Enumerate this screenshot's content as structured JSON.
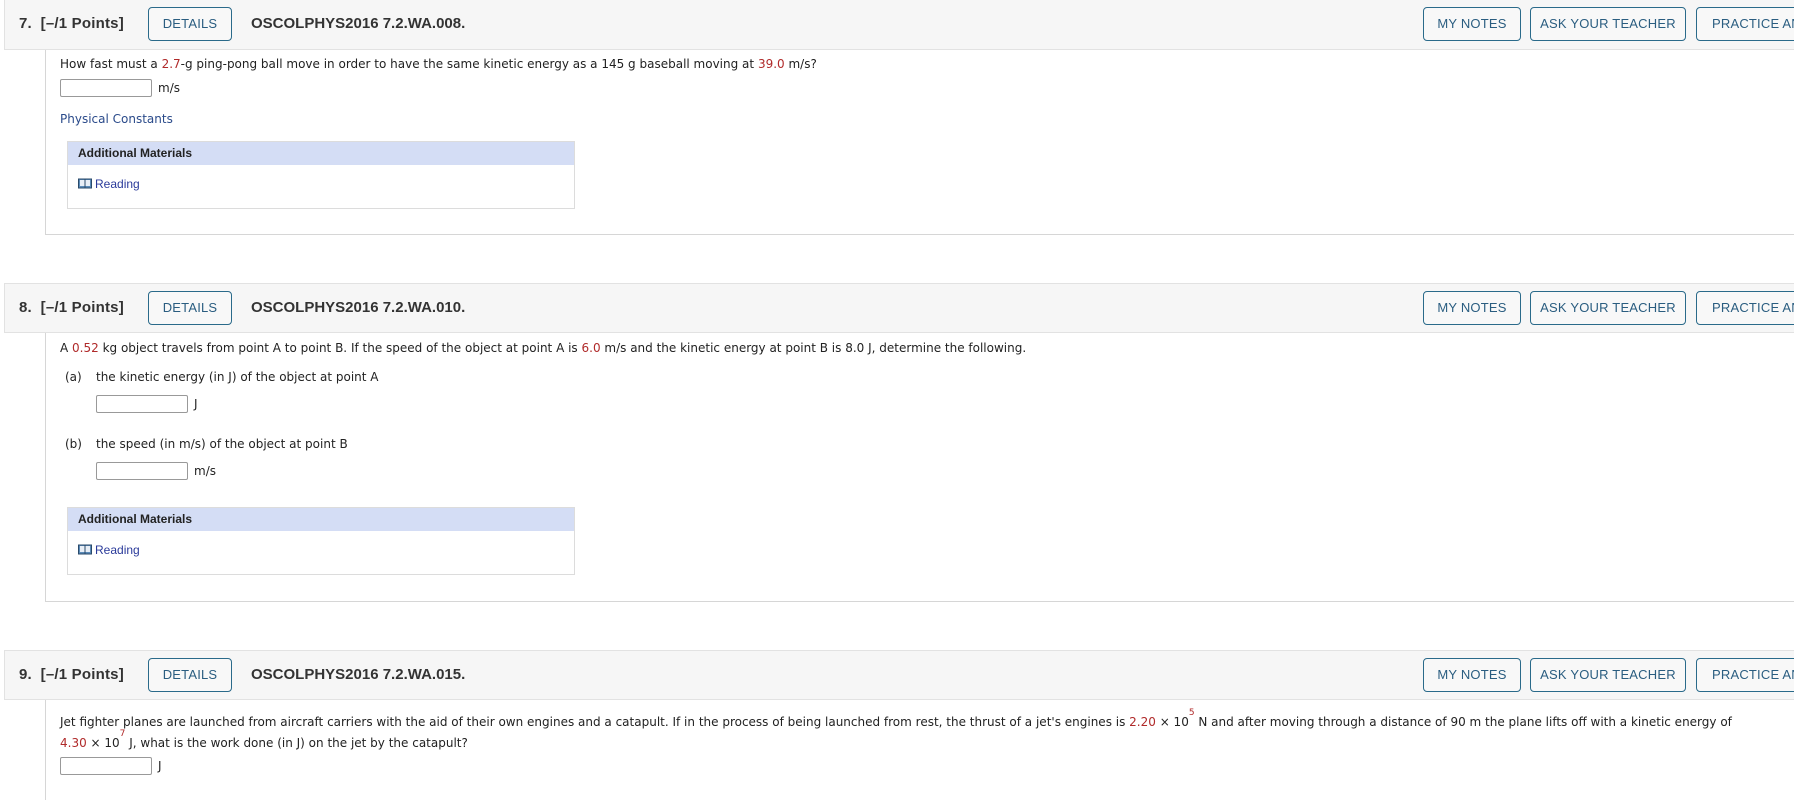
{
  "questions": [
    {
      "number": "7.",
      "points": "[–/1 Points]",
      "details_label": "DETAILS",
      "code": "OSCOLPHYS2016 7.2.WA.008.",
      "my_notes_label": "MY NOTES",
      "ask_teacher_label": "ASK YOUR TEACHER",
      "practice_label": "PRACTICE ANOTHER",
      "prompt": {
        "p1": "How fast must a ",
        "v1": "2.7",
        "p2": "-g ping-pong ball move in order to have the same kinetic energy as a 145 g baseball moving at ",
        "v2": "39.0",
        "p3": " m/s?"
      },
      "answer": {
        "value": "",
        "unit": "m/s"
      },
      "physical_constants_label": "Physical Constants",
      "additional_materials": {
        "title": "Additional Materials",
        "items": [
          {
            "icon": "book-icon",
            "label": "Reading"
          }
        ]
      }
    },
    {
      "number": "8.",
      "points": "[–/1 Points]",
      "details_label": "DETAILS",
      "code": "OSCOLPHYS2016 7.2.WA.010.",
      "my_notes_label": "MY NOTES",
      "ask_teacher_label": "ASK YOUR TEACHER",
      "practice_label": "PRACTICE ANOTHER",
      "prompt": {
        "p1": "A ",
        "v1": "0.52",
        "p2": " kg object travels from point A to point B. If the speed of the object at point A is ",
        "v2": "6.0",
        "p3": " m/s and the kinetic energy at point B is 8.0 J, determine the following."
      },
      "parts": [
        {
          "label": "(a)",
          "text": "the kinetic energy (in J) of the object at point A",
          "value": "",
          "unit": "J"
        },
        {
          "label": "(b)",
          "text": "the speed (in m/s) of the object at point B",
          "value": "",
          "unit": "m/s"
        }
      ],
      "additional_materials": {
        "title": "Additional Materials",
        "items": [
          {
            "icon": "book-icon",
            "label": "Reading"
          }
        ]
      }
    },
    {
      "number": "9.",
      "points": "[–/1 Points]",
      "details_label": "DETAILS",
      "code": "OSCOLPHYS2016 7.2.WA.015.",
      "my_notes_label": "MY NOTES",
      "ask_teacher_label": "ASK YOUR TEACHER",
      "practice_label": "PRACTICE ANOTHER",
      "prompt": {
        "p1": "Jet fighter planes are launched from aircraft carriers with the aid of their own engines and a catapult. If in the process of being launched from rest, the thrust of a jet's engines is ",
        "v1": "2.20",
        "times": " × 10",
        "exp1": "5",
        "p2": " N and after moving through a distance of 90 m the plane lifts off with a kinetic energy of",
        "v2": "4.30",
        "times2": " × 10",
        "exp2": "7",
        "p3": " J, what is the work done (in J) on the jet by the catapult?"
      },
      "answer": {
        "value": "",
        "unit": "J"
      }
    }
  ],
  "colors": {
    "value_red": "#b02a2a",
    "button_border": "#2a6a8a",
    "materials_header": "#d4ddf5",
    "link": "#2a4a8a"
  }
}
